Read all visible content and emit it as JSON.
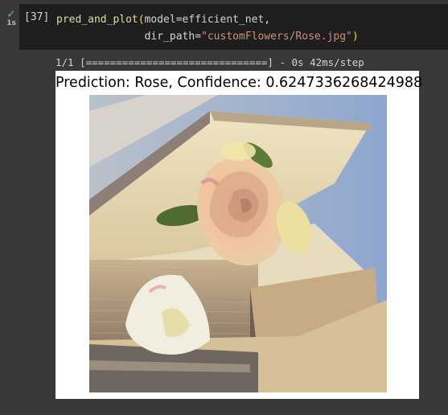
{
  "cell": {
    "status_icon": "check-icon",
    "exec_time": "1s",
    "execution_count": "[37]",
    "code": {
      "fn_name": "pred_and_plot",
      "arg1": "model=efficient_net,",
      "arg2_key": "dir_path=",
      "arg2_value": "\"customFlowers/Rose.jpg\""
    }
  },
  "output": {
    "progress_text": "1/1 [==============================] - 0s 42ms/step",
    "figure_title": "Prediction: Rose, Confidence: 0.6247336268424988",
    "image_subject": "rose-on-open-book-photo"
  }
}
